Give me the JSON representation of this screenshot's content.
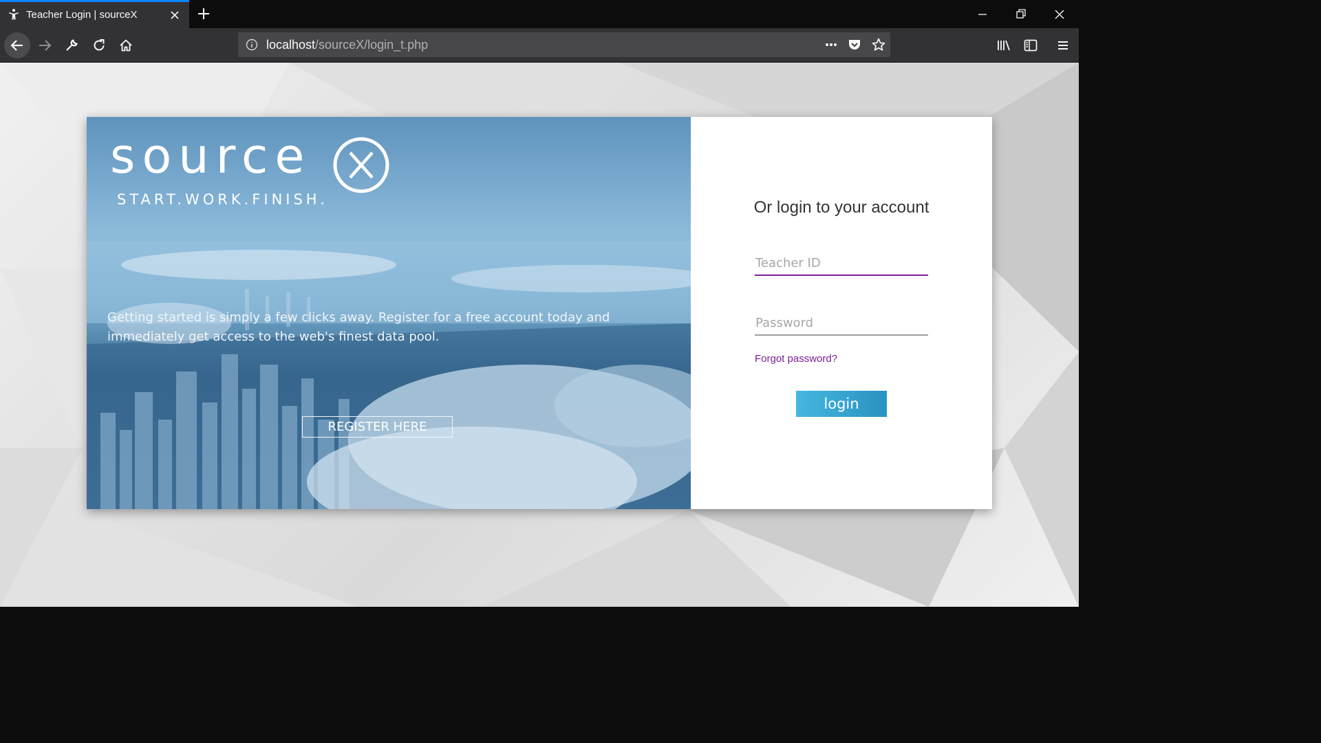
{
  "browser": {
    "tab": {
      "title": "Teacher Login | sourceX",
      "favicon": "accessibility-person-icon"
    },
    "url": {
      "host": "localhost",
      "path": "/sourceX/login_t.php"
    },
    "icons": [
      "back-arrow-icon",
      "forward-arrow-icon",
      "wrench-icon",
      "reload-icon",
      "home-icon",
      "info-icon",
      "more-dots-icon",
      "pocket-icon",
      "bookmark-star-icon",
      "library-icon",
      "sidebar-icon",
      "hamburger-menu-icon",
      "minimize-icon",
      "restore-icon",
      "close-window-icon",
      "new-tab-icon",
      "close-tab-icon"
    ],
    "accent": "#0a84ff"
  },
  "hero": {
    "logo_word": "source",
    "tagline": "START.WORK.FINISH.",
    "description": "Getting started is simply a few clicks away. Register for a free account today and immediately get access to the web's finest data pool.",
    "register_label": "REGISTER HERE"
  },
  "login": {
    "title": "Or login to your account",
    "teacher_id_placeholder": "Teacher ID",
    "password_placeholder": "Password",
    "forgot_label": "Forgot password?",
    "login_label": "login",
    "accent": "#7a1f94",
    "button_color": "#2a92c0"
  }
}
